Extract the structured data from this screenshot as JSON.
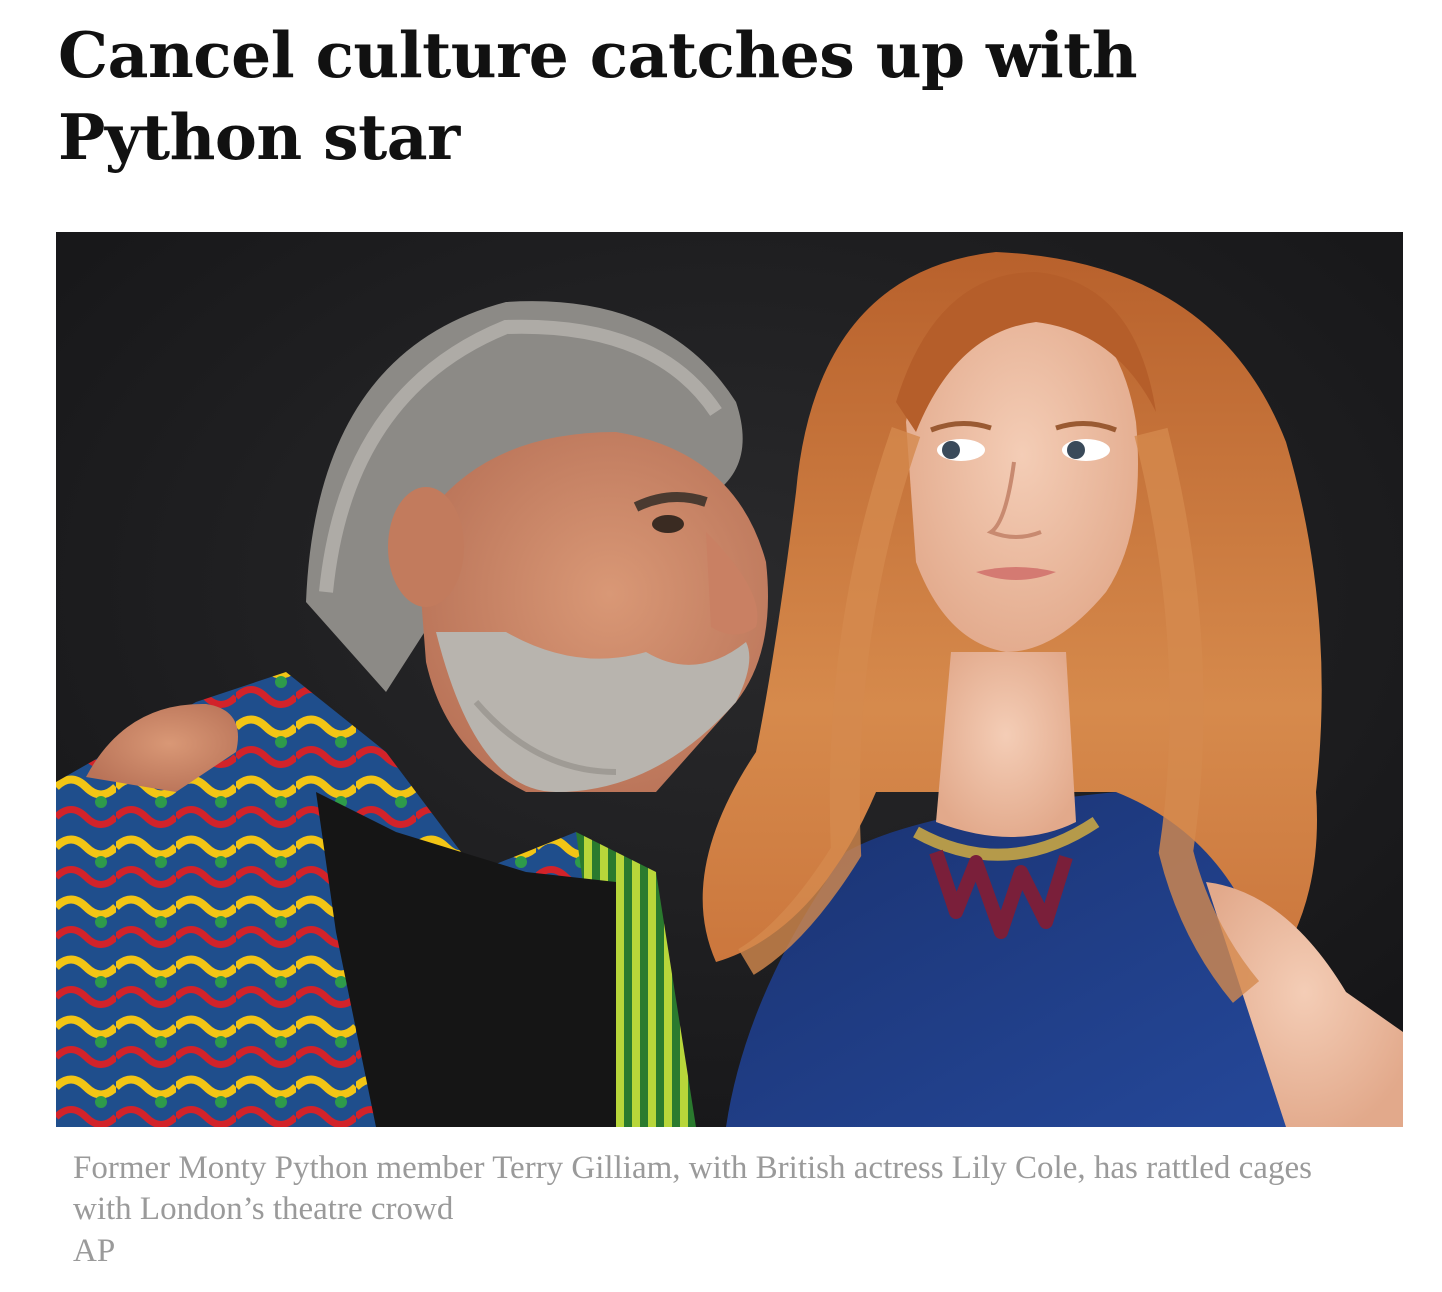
{
  "article": {
    "headline": "Cancel culture catches up with Python star",
    "caption": "Former Monty Python member Terry Gilliam, with British actress Lily Cole, has rattled cages with London’s theatre crowd",
    "credit": "AP"
  },
  "photo": {
    "icon": "photo-image",
    "colors": {
      "background": "#1e1e20",
      "hair_red": "#c9733a",
      "dress_blue": "#1d3b7a",
      "beard_grey": "#b8b4ae",
      "skin": "#e8b49a"
    }
  }
}
